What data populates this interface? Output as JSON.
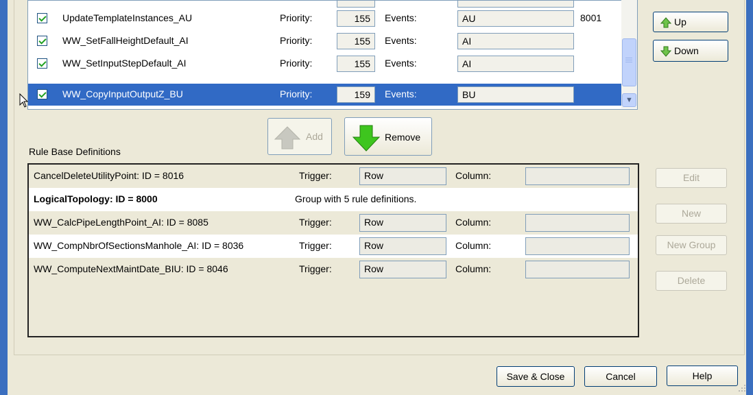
{
  "stored_rules": [
    {
      "name": "UpdateTemplateInstances_AU",
      "priority_label": "Priority:",
      "priority": "155",
      "events_label": "Events:",
      "events": "AU",
      "id": "8001",
      "checked": true,
      "selected": false
    },
    {
      "name": "WW_SetFallHeightDefault_AI",
      "priority_label": "Priority:",
      "priority": "155",
      "events_label": "Events:",
      "events": "AI",
      "id": "",
      "checked": true,
      "selected": false
    },
    {
      "name": "WW_SetInputStepDefault_AI",
      "priority_label": "Priority:",
      "priority": "155",
      "events_label": "Events:",
      "events": "AI",
      "id": "",
      "checked": true,
      "selected": false
    },
    {
      "name": "WW_CopyInputOutputZ_BU",
      "priority_label": "Priority:",
      "priority": "159",
      "events_label": "Events:",
      "events": "BU",
      "id": "",
      "checked": true,
      "selected": true
    }
  ],
  "buttons": {
    "up": "Up",
    "down": "Down",
    "add": "Add",
    "remove": "Remove",
    "edit": "Edit",
    "new": "New",
    "new_group": "New Group",
    "delete": "Delete",
    "save_close": "Save & Close",
    "cancel": "Cancel",
    "help": "Help"
  },
  "rule_base": {
    "label": "Rule Base Definitions",
    "rows": [
      {
        "name": "CancelDeleteUtilityPoint: ID = 8016",
        "trigger_label": "Trigger:",
        "trigger": "Row",
        "column_label": "Column:",
        "column": ""
      },
      {
        "name": "LogicalTopology: ID = 8000",
        "group_text": "Group with 5 rule definitions."
      },
      {
        "name": "WW_CalcPipeLengthPoint_AI: ID = 8085",
        "trigger_label": "Trigger:",
        "trigger": "Row",
        "column_label": "Column:",
        "column": ""
      },
      {
        "name": "WW_CompNbrOfSectionsManhole_AI: ID = 8036",
        "trigger_label": "Trigger:",
        "trigger": "Row",
        "column_label": "Column:",
        "column": ""
      },
      {
        "name": "WW_ComputeNextMaintDate_BIU: ID = 8046",
        "trigger_label": "Trigger:",
        "trigger": "Row",
        "column_label": "Column:",
        "column": ""
      }
    ]
  },
  "colors": {
    "selection": "#316ac5",
    "frame": "#3b6fbf",
    "dialog": "#ece9d8"
  }
}
